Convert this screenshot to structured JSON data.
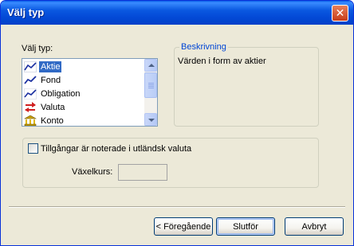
{
  "window": {
    "title": "Välj typ",
    "close_glyph": "✕"
  },
  "type_selector": {
    "label": "Välj typ:",
    "items": [
      {
        "label": "Aktie",
        "icon": "stock-chart-icon",
        "selected": true
      },
      {
        "label": "Fond",
        "icon": "fund-chart-icon",
        "selected": false
      },
      {
        "label": "Obligation",
        "icon": "bond-chart-icon",
        "selected": false
      },
      {
        "label": "Valuta",
        "icon": "currency-exchange-icon",
        "selected": false
      },
      {
        "label": "Konto",
        "icon": "bank-building-icon",
        "selected": false
      }
    ]
  },
  "description": {
    "caption": "Beskrivning",
    "text": "Värden i form av aktier"
  },
  "foreign_currency": {
    "checkbox_label": "Tillgångar är noterade i utländsk valuta",
    "checked": false,
    "rate_label": "Växelkurs:",
    "rate_value": ""
  },
  "buttons": {
    "back": "< Föregående",
    "finish": "Slutför",
    "cancel": "Avbryt"
  },
  "colors": {
    "title_bar": "#0a58e0",
    "dialog_bg": "#ece9d8",
    "selection": "#316ac5",
    "group_caption": "#0046d5"
  }
}
